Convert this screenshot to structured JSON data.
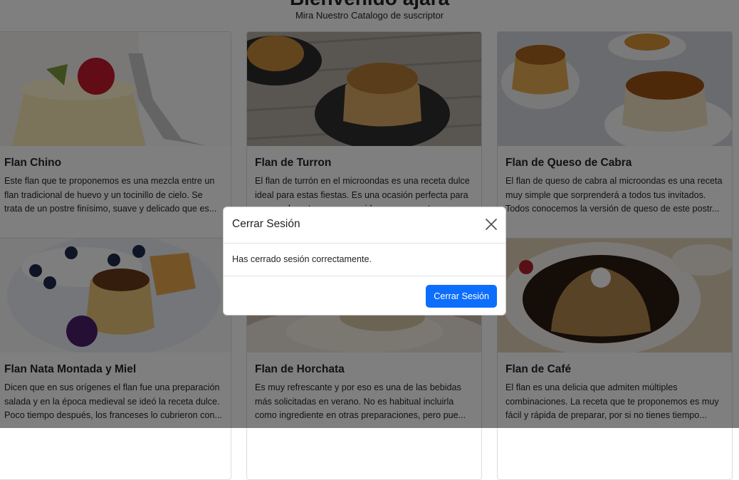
{
  "header": {
    "title": "Bienvenido ajara",
    "subtitle": "Mira Nuestro Catalogo de suscriptor"
  },
  "cards": [
    {
      "title": "Flan Chino",
      "text": "Este flan que te proponemos es una mezcla entre un flan tradicional de huevo y un tocinillo de cielo. Se trata de un postre finísimo, suave y delicado que es..."
    },
    {
      "title": "Flan de Turron",
      "text": "El flan de turrón en el microondas es una receta dulce ideal para estas fiestas. Es una ocasión perfecta para sorprender a tus seres queridos con un postre..."
    },
    {
      "title": "Flan de Queso de Cabra",
      "text": "El flan de queso de cabra al microondas es una receta muy simple que sorprenderá a todos tus invitados. Todos conocemos la versión de queso de este postr..."
    },
    {
      "title": "Flan Nata Montada y Miel",
      "text": "Dicen que en sus orígenes el flan fue una preparación salada y en la época medieval se ideó la receta dulce. Poco tiempo después, los franceses lo cubrieron con..."
    },
    {
      "title": "Flan de Horchata",
      "text": "Es muy refrescante y por eso es una de las bebidas más solicitadas en verano. No es habitual incluirla como ingrediente en otras preparaciones, pero pue..."
    },
    {
      "title": "Flan de Café",
      "text": "El flan es una delicia que admiten múltiples combinaciones. La receta que te proponemos es muy fácil y rápida de preparar, por si no tienes tiempo..."
    }
  ],
  "modal": {
    "title": "Cerrar Sesión",
    "body": "Has cerrado sesión correctamente.",
    "button": "Cerrar Sesión",
    "close_icon": "close-icon"
  },
  "colors": {
    "accent": "#0d6efd",
    "overlay": "rgba(0,0,0,0.5)"
  }
}
